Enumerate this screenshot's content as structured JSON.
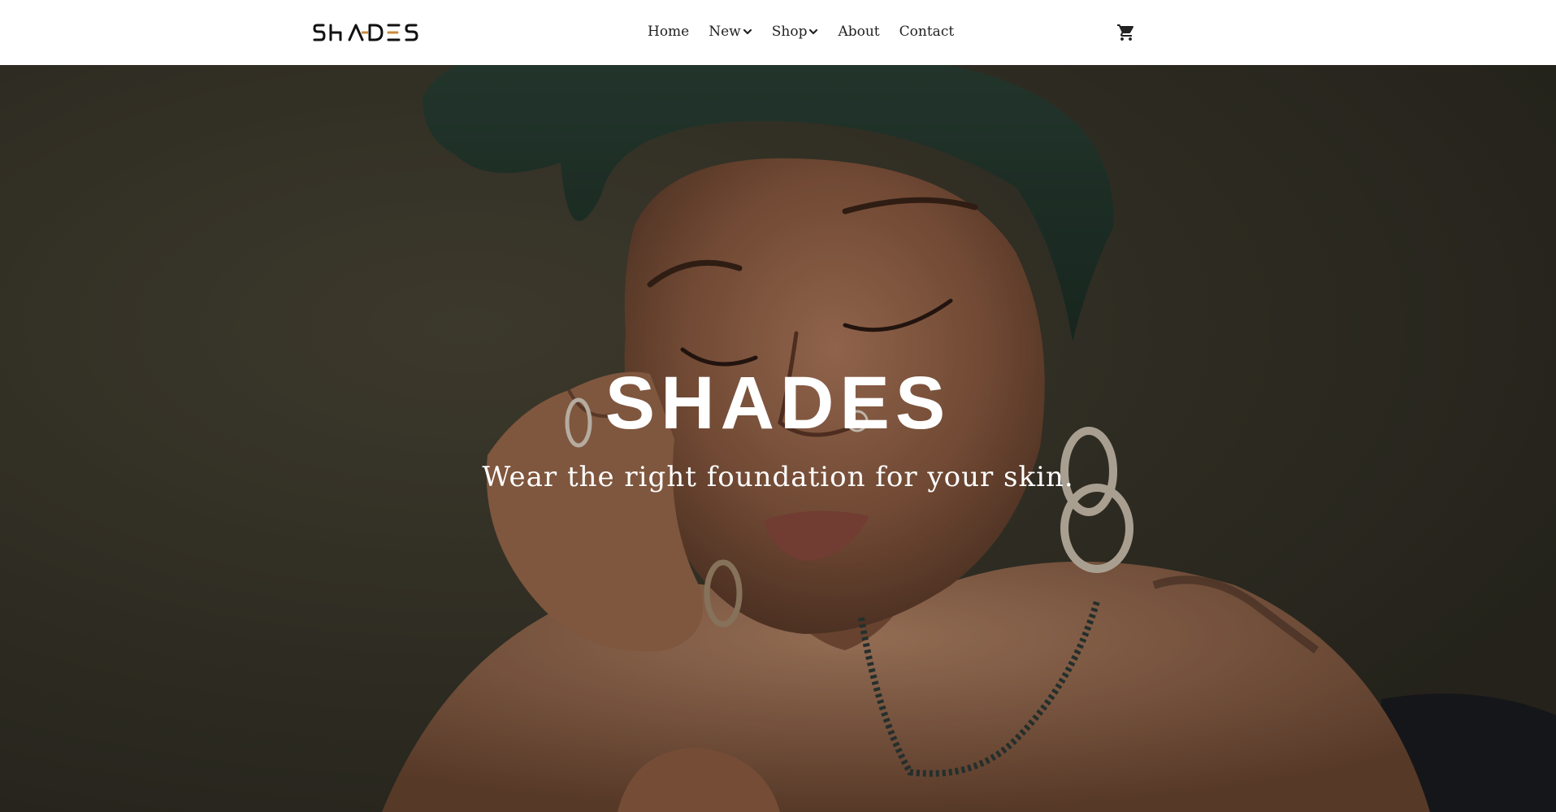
{
  "brand": {
    "logo_text": "SHADES",
    "logo_accent_color": "#c98a3e"
  },
  "nav": {
    "items": [
      {
        "label": "Home",
        "has_dropdown": false
      },
      {
        "label": "New",
        "has_dropdown": true
      },
      {
        "label": "Shop",
        "has_dropdown": true
      },
      {
        "label": "About",
        "has_dropdown": false
      },
      {
        "label": "Contact",
        "has_dropdown": false
      }
    ],
    "cart_icon": "shopping-cart-icon"
  },
  "hero": {
    "title": "SHADES",
    "subtitle": "Wear the right foundation for your skin."
  },
  "colors": {
    "header_bg": "#ffffff",
    "nav_text": "#222222",
    "hero_text": "#ffffff",
    "hero_bg": "#3d3a2e"
  }
}
